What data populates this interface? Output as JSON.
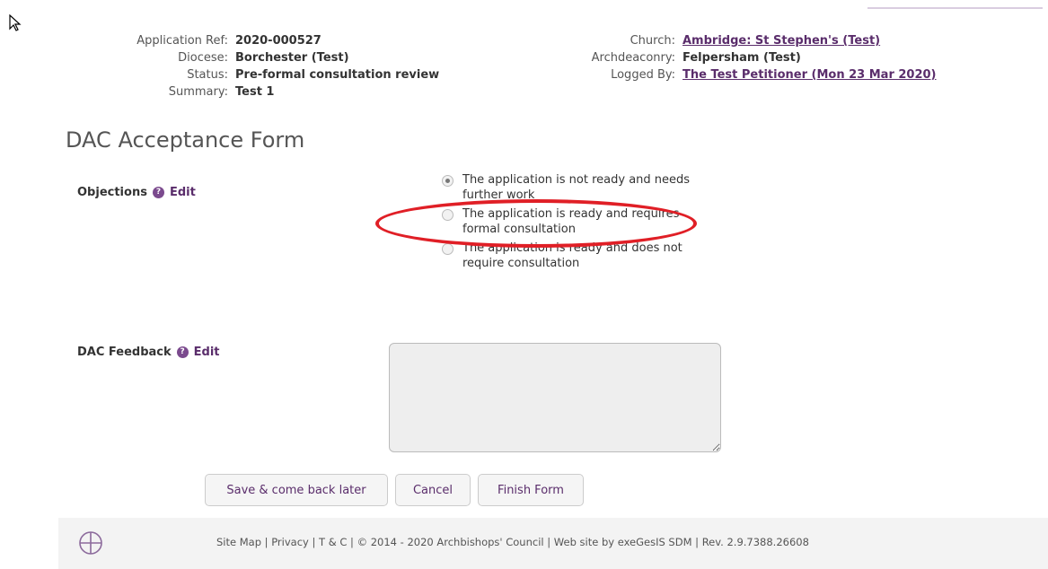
{
  "meta_left": [
    {
      "label": "Application Ref:",
      "value": "2020-000527"
    },
    {
      "label": "Diocese:",
      "value": "Borchester (Test)"
    },
    {
      "label": "Status:",
      "value": "Pre-formal consultation review"
    },
    {
      "label": "Summary:",
      "value": "Test 1"
    }
  ],
  "meta_right": [
    {
      "label": "Church:",
      "value": "Ambridge: St Stephen's (Test)"
    },
    {
      "label": "Archdeaconry:",
      "value": "Felpersham (Test)"
    },
    {
      "label": "Logged By:",
      "value": "The Test Petitioner (Mon 23 Mar 2020)"
    }
  ],
  "form_title": "DAC Acceptance Form",
  "objections": {
    "label": "Objections",
    "help_icon": "?",
    "edit": "Edit",
    "options": [
      {
        "text": "The application is not ready and needs further work",
        "selected": true
      },
      {
        "text": "The application is ready and requires formal consultation",
        "selected": false
      },
      {
        "text": "The application is ready and does not require consultation",
        "selected": false
      }
    ]
  },
  "feedback": {
    "label": "DAC Feedback",
    "help_icon": "?",
    "edit": "Edit",
    "value": ""
  },
  "buttons": {
    "save": "Save & come back later",
    "cancel": "Cancel",
    "finish": "Finish Form"
  },
  "footer": {
    "site_map": "Site Map",
    "privacy": "Privacy",
    "tc": "T & C",
    "copyright": "© 2014 - 2020 Archbishops' Council",
    "website": "Web site by exeGesIS SDM",
    "rev": "Rev. 2.9.7388.26608"
  },
  "colors": {
    "accent": "#5a2d6b",
    "highlight": "#e01f26"
  }
}
